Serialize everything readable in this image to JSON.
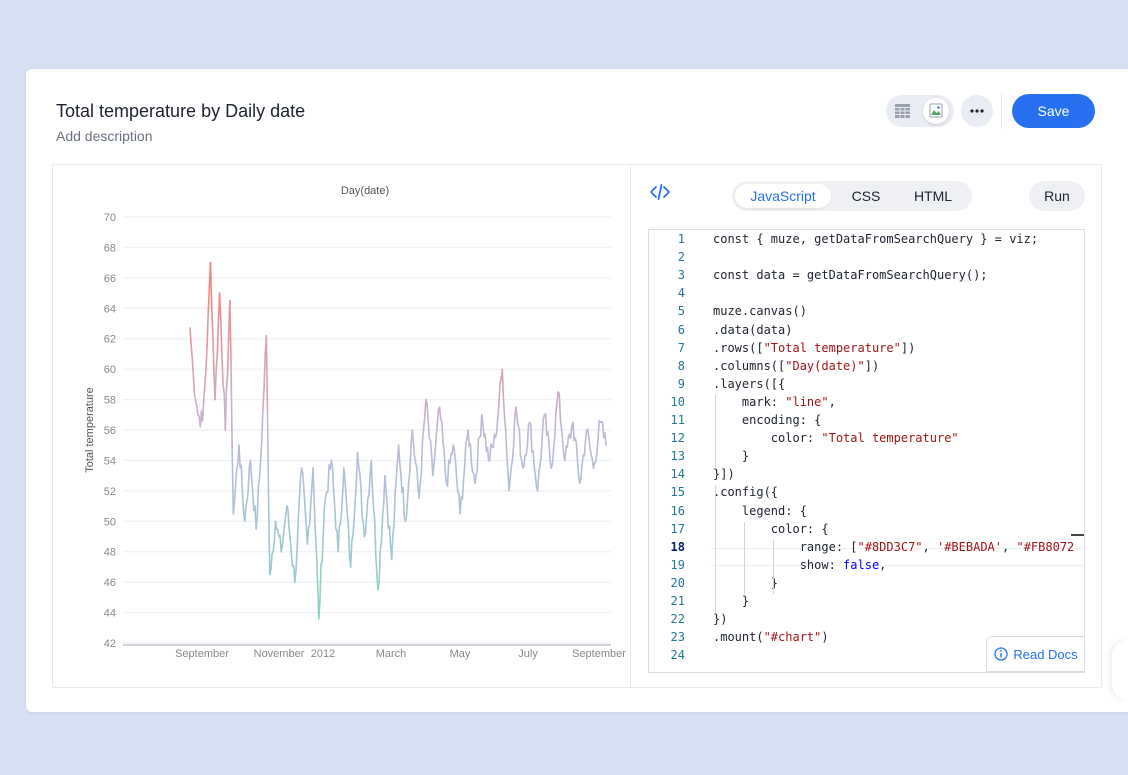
{
  "header": {
    "title": "Total temperature by Daily date",
    "description_placeholder": "Add description",
    "save_label": "Save",
    "more_label": "⋯"
  },
  "editor": {
    "tabs": [
      {
        "label": "JavaScript",
        "active": true
      },
      {
        "label": "CSS",
        "active": false
      },
      {
        "label": "HTML",
        "active": false
      }
    ],
    "run_label": "Run",
    "read_docs_label": "Read Docs",
    "current_line": 18,
    "line_numbers": [
      "1",
      "2",
      "3",
      "4",
      "5",
      "6",
      "7",
      "8",
      "9",
      "10",
      "11",
      "12",
      "13",
      "14",
      "15",
      "16",
      "17",
      "18",
      "19",
      "20",
      "21",
      "22",
      "23",
      "24"
    ],
    "code_lines": [
      "const { muze, getDataFromSearchQuery } = viz;",
      "",
      "const data = getDataFromSearchQuery();",
      "",
      "muze.canvas()",
      ".data(data)",
      ".rows([\"Total temperature\"])",
      ".columns([\"Day(date)\"])",
      ".layers([{",
      "    mark: \"line\",",
      "    encoding: {",
      "        color: \"Total temperature\"",
      "    }",
      "}])",
      ".config({",
      "    legend: {",
      "        color: {",
      "            range: [\"#8DD3C7\", '#BEBADA', \"#FB8072",
      "            show: false,",
      "        }",
      "    }",
      "})",
      ".mount(\"#chart\")",
      ""
    ]
  },
  "colors": {
    "accent": "#2770ef",
    "background": "#d8e0f3",
    "line_low": "#8DD3C7",
    "line_mid": "#BEBADA",
    "line_high": "#FB8072"
  },
  "chart_data": {
    "type": "line",
    "title": "Day(date)",
    "xlabel": "",
    "ylabel": "Total temperature",
    "ylim": [
      42,
      70
    ],
    "yticks": [
      42,
      44,
      46,
      48,
      50,
      52,
      54,
      56,
      58,
      60,
      62,
      64,
      66,
      68,
      70
    ],
    "xticks": [
      "September",
      "November",
      "2012",
      "March",
      "May",
      "July",
      "September"
    ],
    "grid": true,
    "legend": "none",
    "x_start": "2011-10-01",
    "x_end": "2012-09-30",
    "anchors": [
      [
        "2011-10-01",
        62.7
      ],
      [
        "2011-10-04",
        59.5
      ],
      [
        "2011-10-08",
        57.0
      ],
      [
        "2011-10-12",
        56.6
      ],
      [
        "2011-10-16",
        61.5
      ],
      [
        "2011-10-19",
        67.0
      ],
      [
        "2011-10-23",
        58.0
      ],
      [
        "2011-10-27",
        65.0
      ],
      [
        "2011-11-01",
        56.0
      ],
      [
        "2011-11-05",
        64.5
      ],
      [
        "2011-11-08",
        50.5
      ],
      [
        "2011-11-13",
        55.0
      ],
      [
        "2011-11-18",
        50.0
      ],
      [
        "2011-11-23",
        54.0
      ],
      [
        "2011-11-28",
        49.5
      ],
      [
        "2011-12-02",
        54.0
      ],
      [
        "2011-12-07",
        62.2
      ],
      [
        "2011-12-10",
        46.5
      ],
      [
        "2011-12-15",
        50.0
      ],
      [
        "2011-12-20",
        48.0
      ],
      [
        "2011-12-25",
        51.0
      ],
      [
        "2012-01-01",
        46.0
      ],
      [
        "2012-01-07",
        53.5
      ],
      [
        "2012-01-12",
        48.5
      ],
      [
        "2012-01-17",
        53.5
      ],
      [
        "2012-01-22",
        43.6
      ],
      [
        "2012-01-27",
        51.0
      ],
      [
        "2012-02-02",
        54.0
      ],
      [
        "2012-02-08",
        48.0
      ],
      [
        "2012-02-13",
        53.5
      ],
      [
        "2012-02-19",
        47.0
      ],
      [
        "2012-02-25",
        54.5
      ],
      [
        "2012-03-02",
        49.0
      ],
      [
        "2012-03-08",
        54.0
      ],
      [
        "2012-03-14",
        45.5
      ],
      [
        "2012-03-20",
        53.0
      ],
      [
        "2012-03-26",
        47.5
      ],
      [
        "2012-04-01",
        55.0
      ],
      [
        "2012-04-07",
        50.0
      ],
      [
        "2012-04-13",
        56.0
      ],
      [
        "2012-04-19",
        51.5
      ],
      [
        "2012-04-25",
        58.0
      ],
      [
        "2012-05-01",
        53.0
      ],
      [
        "2012-05-07",
        57.5
      ],
      [
        "2012-05-13",
        52.5
      ],
      [
        "2012-05-19",
        55.0
      ],
      [
        "2012-05-25",
        50.5
      ],
      [
        "2012-06-01",
        56.0
      ],
      [
        "2012-06-07",
        52.5
      ],
      [
        "2012-06-13",
        57.0
      ],
      [
        "2012-06-19",
        54.0
      ],
      [
        "2012-06-25",
        55.5
      ],
      [
        "2012-07-01",
        60.0
      ],
      [
        "2012-07-07",
        52.0
      ],
      [
        "2012-07-13",
        57.5
      ],
      [
        "2012-07-19",
        53.5
      ],
      [
        "2012-07-25",
        56.5
      ],
      [
        "2012-08-01",
        52.0
      ],
      [
        "2012-08-07",
        57.0
      ],
      [
        "2012-08-13",
        53.5
      ],
      [
        "2012-08-19",
        58.5
      ],
      [
        "2012-08-25",
        54.0
      ],
      [
        "2012-09-01",
        56.5
      ],
      [
        "2012-09-07",
        52.5
      ],
      [
        "2012-09-13",
        56.0
      ],
      [
        "2012-09-19",
        53.5
      ],
      [
        "2012-09-25",
        56.5
      ],
      [
        "2012-09-30",
        55.0
      ]
    ]
  }
}
